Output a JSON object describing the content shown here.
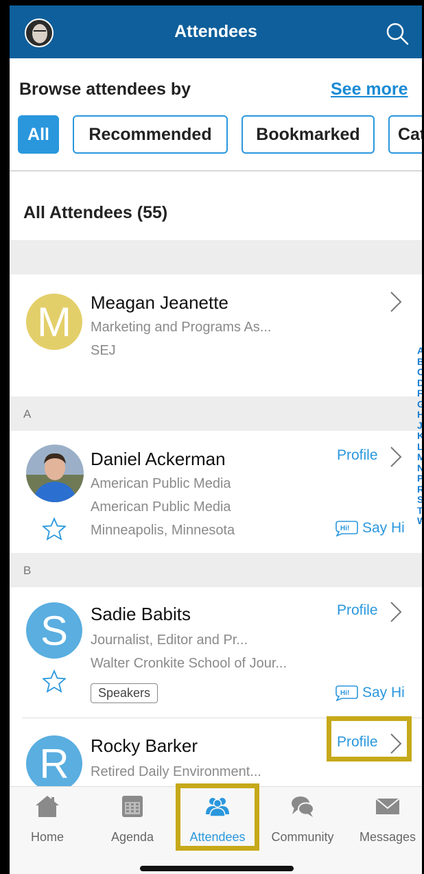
{
  "header": {
    "title": "Attendees"
  },
  "browse": {
    "label": "Browse attendees by",
    "see_more": "See more"
  },
  "chips": [
    "All",
    "Recommended",
    "Bookmarked",
    "Cat"
  ],
  "list": {
    "title": "All Attendees (55)"
  },
  "featured": {
    "initial": "M",
    "name": "Meagan Jeanette",
    "line1": "Marketing and Programs As...",
    "line2": "SEJ",
    "avatar_color": "#e3cf6a"
  },
  "sections": {
    "a": "A",
    "b": "B"
  },
  "attendees": [
    {
      "name": "Daniel Ackerman",
      "line1": "American Public Media",
      "line2": "American Public Media",
      "line3": "Minneapolis, Minnesota",
      "profile": "Profile",
      "say_hi": "Say Hi"
    },
    {
      "initial": "S",
      "name": "Sadie Babits",
      "line1": "Journalist, Editor and Pr...",
      "line2": "Walter Cronkite School of Jour...",
      "badge": "Speakers",
      "profile": "Profile",
      "say_hi": "Say Hi",
      "avatar_color": "#5aaee0"
    },
    {
      "initial": "R",
      "name": "Rocky Barker",
      "line1": "Retired Daily Environment...",
      "profile": "Profile",
      "avatar_color": "#5aaee0"
    }
  ],
  "index_letters": [
    "A",
    "B",
    "C",
    "D",
    "F",
    "G",
    "H",
    "J",
    "K",
    "L",
    "M",
    "N",
    "P",
    "R",
    "S",
    "T",
    "W"
  ],
  "tabs": [
    {
      "label": "Home",
      "icon": "home-icon"
    },
    {
      "label": "Agenda",
      "icon": "calendar-icon"
    },
    {
      "label": "Attendees",
      "icon": "people-icon"
    },
    {
      "label": "Community",
      "icon": "chat-icon"
    },
    {
      "label": "Messages",
      "icon": "envelope-icon"
    }
  ],
  "colors": {
    "header_bg": "#0e5f9b",
    "accent": "#2a97dd",
    "highlight": "#c6a91a"
  }
}
